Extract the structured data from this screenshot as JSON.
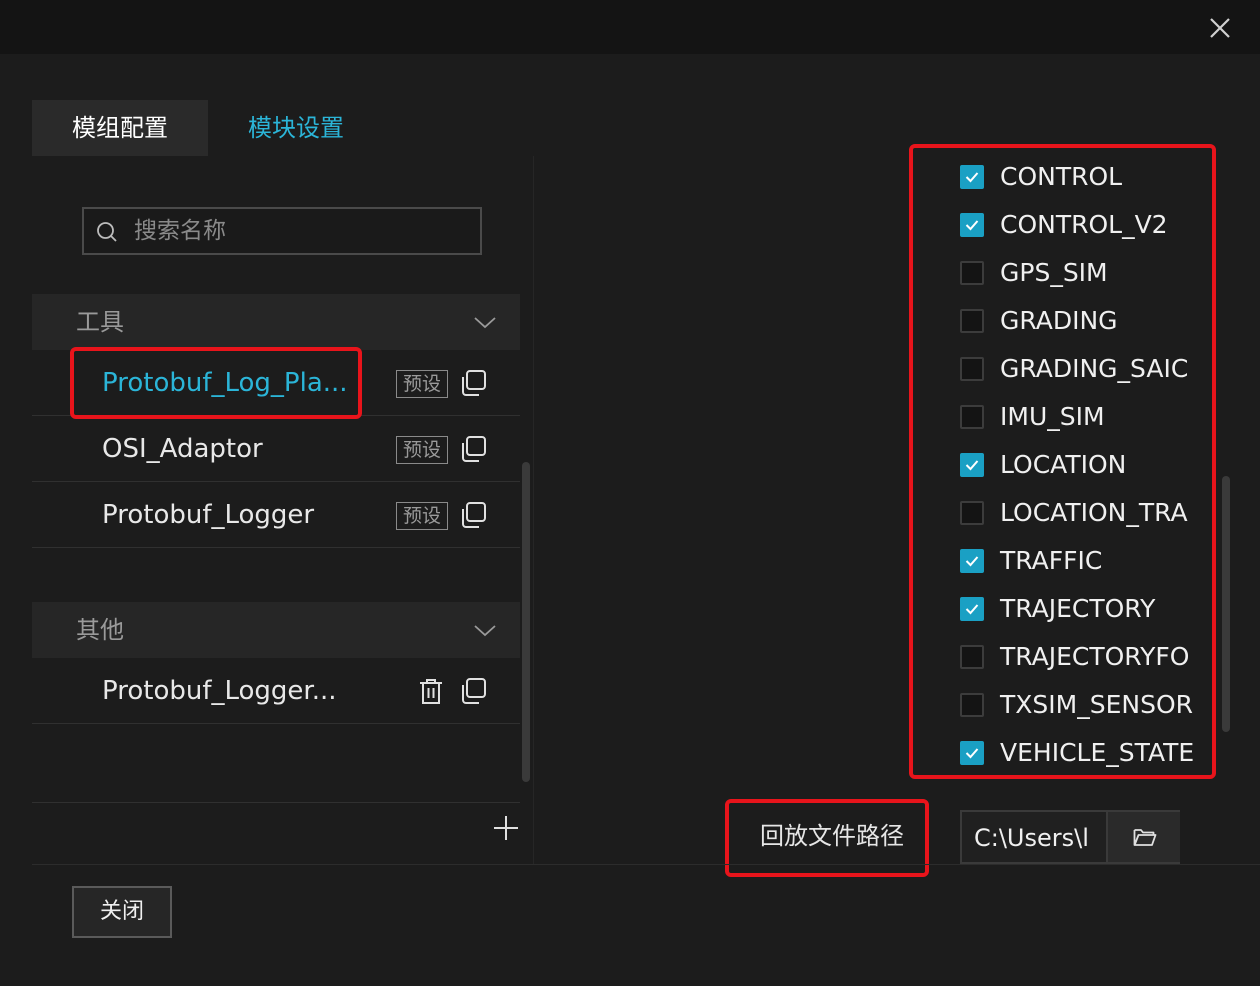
{
  "tabs": [
    {
      "label": "模组配置",
      "active": true
    },
    {
      "label": "模块设置",
      "active": false
    }
  ],
  "search": {
    "placeholder": "搜索名称"
  },
  "groups": [
    {
      "title": "工具",
      "items": [
        {
          "name": "Protobuf_Log_Pla...",
          "badge": "预设",
          "selected": true
        },
        {
          "name": "OSI_Adaptor",
          "badge": "预设"
        },
        {
          "name": "Protobuf_Logger",
          "badge": "预设"
        }
      ]
    },
    {
      "title": "其他",
      "items": [
        {
          "name": "Protobuf_Logger..."
        }
      ]
    }
  ],
  "footer": {
    "close_label": "关闭"
  },
  "topics": [
    {
      "label": "CONTROL",
      "checked": true
    },
    {
      "label": "CONTROL_V2",
      "checked": true
    },
    {
      "label": "GPS_SIM",
      "checked": false
    },
    {
      "label": "GRADING",
      "checked": false
    },
    {
      "label": "GRADING_SAIC",
      "checked": false
    },
    {
      "label": "IMU_SIM",
      "checked": false
    },
    {
      "label": "LOCATION",
      "checked": true
    },
    {
      "label": "LOCATION_TRA",
      "checked": false
    },
    {
      "label": "TRAFFIC",
      "checked": true
    },
    {
      "label": "TRAJECTORY",
      "checked": true
    },
    {
      "label": "TRAJECTORYFO",
      "checked": false
    },
    {
      "label": "TXSIM_SENSOR",
      "checked": false
    },
    {
      "label": "VEHICLE_STATE",
      "checked": true
    }
  ],
  "playback": {
    "label": "回放文件路径",
    "path_value": "C:\\Users\\l"
  },
  "colors": {
    "accent": "#2bb5d8",
    "checkbox": "#1aa0c4",
    "highlight_border": "#e8141b"
  }
}
